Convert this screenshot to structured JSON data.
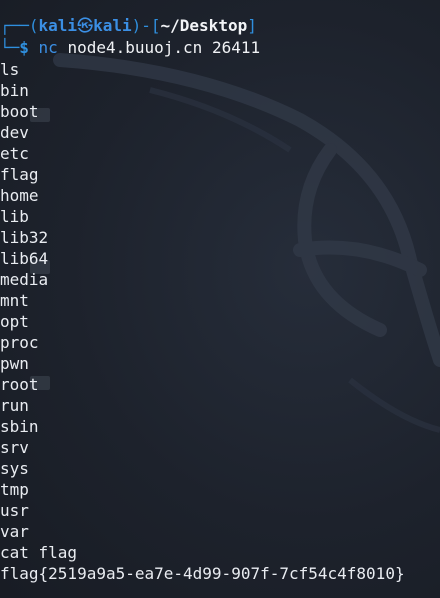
{
  "prompt": {
    "corner_top": "┌──(",
    "user": "kali",
    "at": "㉿",
    "host": "kali",
    "mid": ")-[",
    "cwd": "~/Desktop",
    "end": "]",
    "corner_bottom": "└─",
    "dollar": "$",
    "command": "nc",
    "args": "node4.buuoj.cn 26411"
  },
  "output_lines": [
    "ls",
    "bin",
    "boot",
    "dev",
    "etc",
    "flag",
    "home",
    "lib",
    "lib32",
    "lib64",
    "media",
    "mnt",
    "opt",
    "proc",
    "pwn",
    "root",
    "run",
    "sbin",
    "srv",
    "sys",
    "tmp",
    "usr",
    "var",
    "cat flag",
    "flag{2519a9a5-ea7e-4d99-907f-7cf54c4f8010}"
  ],
  "colors": {
    "background": "#1c2029",
    "prompt_blue": "#3b8fe4",
    "text": "#e9ecf1"
  }
}
